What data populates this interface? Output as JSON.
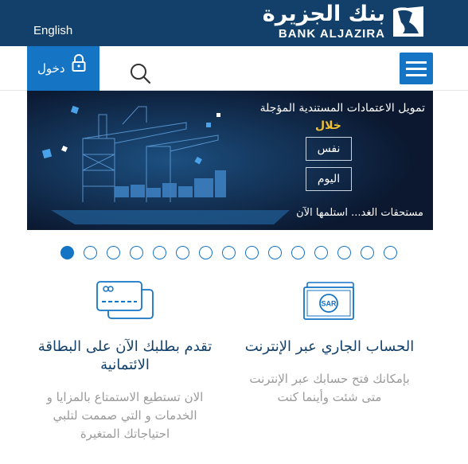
{
  "header": {
    "language_label": "English",
    "logo_arabic": "بنك الجزيرة",
    "logo_english": "BANK ALJAZIRA"
  },
  "nav": {
    "login_label": "دخول",
    "icons": [
      "lock-icon",
      "search-icon",
      "hamburger-menu-icon"
    ]
  },
  "banner": {
    "title": "تمويل الاعتمادات المستندية المؤجلة",
    "within": "خلال",
    "box1": "نفس",
    "box2": "اليوم",
    "bottom": "مستحقات الغد... استلمها الآن"
  },
  "carousel": {
    "total": 15,
    "active_index": 0
  },
  "cards": [
    {
      "icon": "sar-banknote-icon",
      "title": "الحساب الجاري عبر الإنترنت",
      "description": "بإمكانك فتح حسابك عبر الإنترنت متى شئت وأينما كنت"
    },
    {
      "icon": "credit-card-icon",
      "title": "تقدم بطلبك الآن على البطاقة الائتمانية",
      "description": "الان تستطيع الاستمتاع بالمزايا و الخدمات و التي صممت لتلبي احتياجاتك المتغيرة"
    }
  ],
  "colors": {
    "header_bg": "#12406a",
    "accent_blue": "#1674c4",
    "banner_bg": "#0b1830",
    "banner_highlight": "#f2c030"
  }
}
